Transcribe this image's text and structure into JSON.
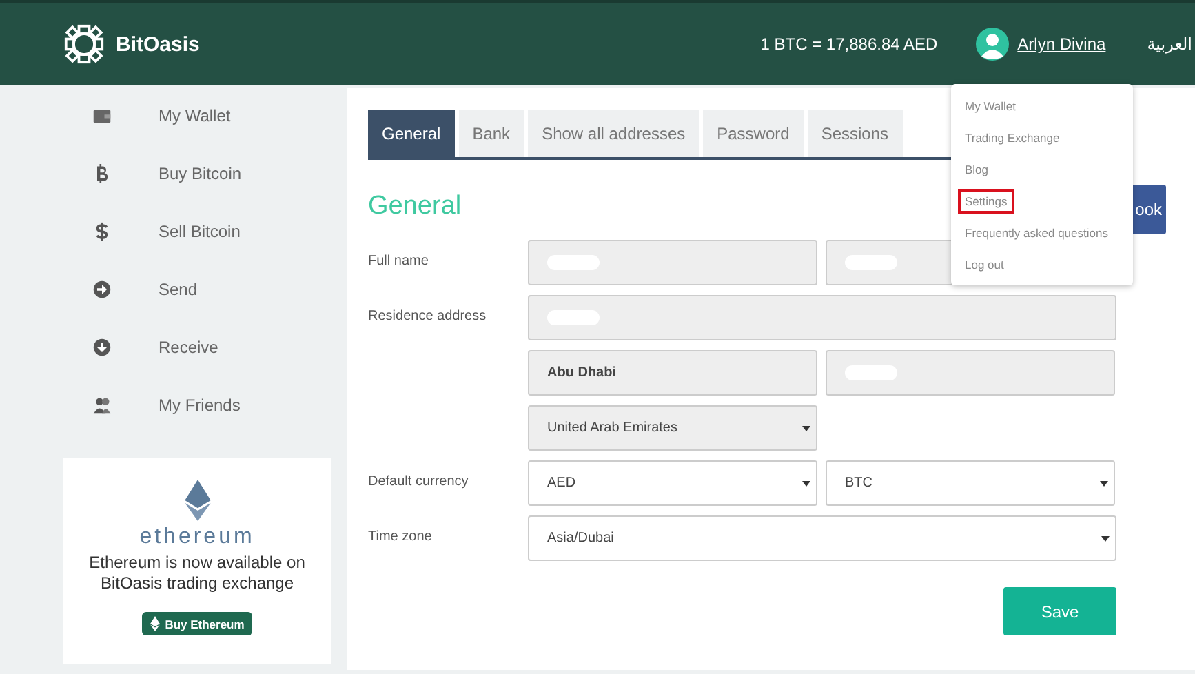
{
  "header": {
    "brand": "BitOasis",
    "rate": "1 BTC = 17,886.84 AED",
    "user": "Arlyn Divina",
    "language": "العربية"
  },
  "user_menu": {
    "items": [
      {
        "label": "My Wallet",
        "highlighted": false
      },
      {
        "label": "Trading Exchange",
        "highlighted": false
      },
      {
        "label": "Blog",
        "highlighted": false
      },
      {
        "label": "Settings",
        "highlighted": true
      },
      {
        "label": "Frequently asked questions",
        "highlighted": false
      },
      {
        "label": "Log out",
        "highlighted": false
      }
    ]
  },
  "sidebar": {
    "items": [
      {
        "label": "My Wallet"
      },
      {
        "label": "Buy Bitcoin"
      },
      {
        "label": "Sell Bitcoin"
      },
      {
        "label": "Send"
      },
      {
        "label": "Receive"
      },
      {
        "label": "My Friends"
      }
    ]
  },
  "promo": {
    "logo_text": "ethereum",
    "text": "Ethereum is now available on BitOasis trading exchange",
    "button": "Buy Ethereum"
  },
  "tabs": [
    {
      "label": "General",
      "selected": true
    },
    {
      "label": "Bank",
      "selected": false
    },
    {
      "label": "Show all addresses",
      "selected": false
    },
    {
      "label": "Password",
      "selected": false
    },
    {
      "label": "Sessions",
      "selected": false
    }
  ],
  "heading": "General",
  "partly_hidden_button": {
    "label": "ook"
  },
  "form": {
    "rows": [
      {
        "label": "Full name",
        "fields": [
          {
            "kind": "text",
            "redacted": true
          },
          {
            "kind": "text",
            "redacted": true
          }
        ]
      },
      {
        "label": "Residence address",
        "fields": [
          {
            "kind": "wide_text",
            "redacted": true
          }
        ]
      },
      {
        "fields": [
          {
            "kind": "text",
            "value": "Abu Dhabi",
            "redacted": false
          },
          {
            "kind": "text",
            "redacted": true
          }
        ]
      },
      {
        "fields": [
          {
            "kind": "select",
            "value": "United Arab Emirates",
            "disabled": true
          }
        ]
      },
      {
        "label": "Default currency",
        "fields": [
          {
            "kind": "select",
            "value": "AED",
            "disabled": false
          },
          {
            "kind": "select",
            "value": "BTC",
            "disabled": false
          }
        ]
      },
      {
        "label": "Time zone",
        "fields": [
          {
            "kind": "wide_select",
            "value": "Asia/Dubai",
            "disabled": false
          }
        ]
      }
    ]
  },
  "save_button": "Save"
}
